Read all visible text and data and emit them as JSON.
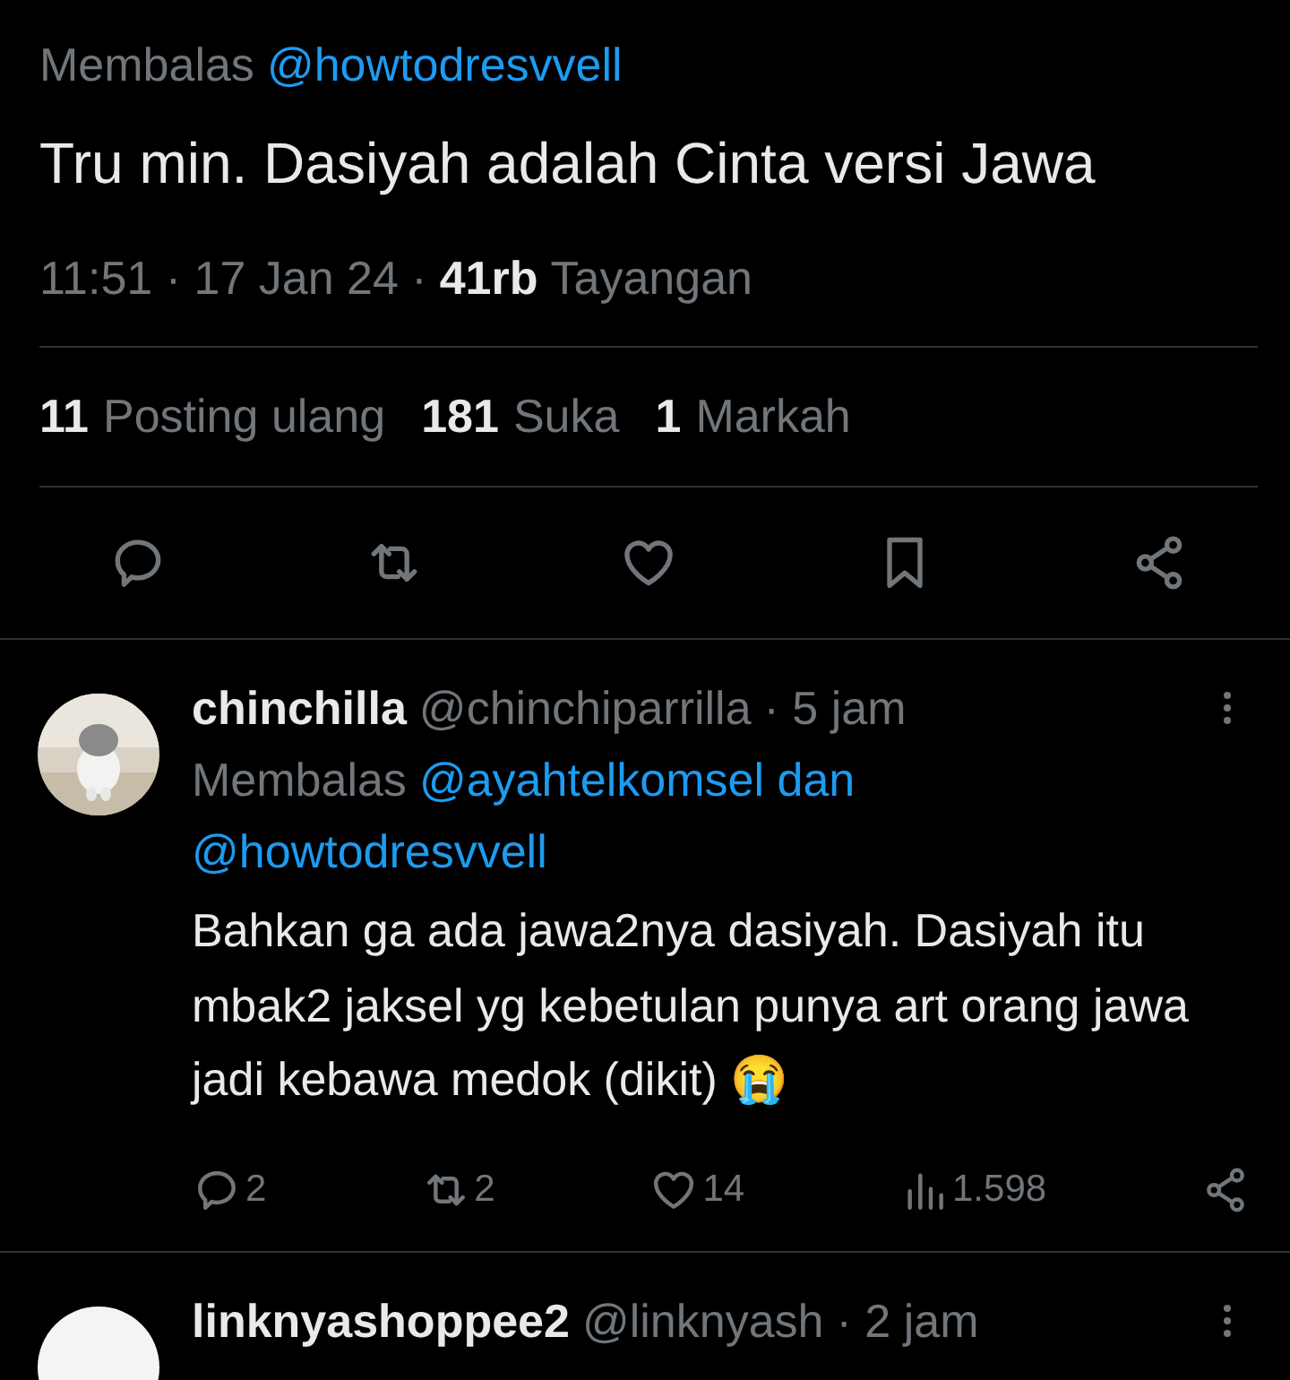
{
  "reply_to": {
    "prefix": "Membalas",
    "handles": [
      "@howtodresvvell"
    ]
  },
  "text": "Tru min. Dasiyah adalah Cinta versi Jawa",
  "meta": {
    "timestamp": "11:51 · 17 Jan 24 ·",
    "views_count": "41rb",
    "views_label": "Tayangan"
  },
  "stats": [
    {
      "count": "11",
      "label": "Posting ulang"
    },
    {
      "count": "181",
      "label": "Suka"
    },
    {
      "count": "1",
      "label": "Markah"
    }
  ],
  "actions": [
    {
      "kind": "reply"
    },
    {
      "kind": "repost"
    },
    {
      "kind": "like"
    },
    {
      "kind": "bookmark"
    },
    {
      "kind": "share"
    }
  ],
  "replies": [
    {
      "name": "chinchilla",
      "handle": "@chinchiparrilla",
      "time": "· 5 jam",
      "reply_to": {
        "prefix": "Membalas",
        "handles": [
          "@ayahtelkomsel dan",
          "@howtodresvvell"
        ]
      },
      "text": "Bahkan ga ada jawa2nya dasiyah. Dasiyah itu mbak2 jaksel yg kebetulan punya art orang jawa jadi kebawa medok (dikit) 😭",
      "actions": [
        {
          "kind": "reply",
          "count": "2"
        },
        {
          "kind": "repost",
          "count": "2"
        },
        {
          "kind": "like",
          "count": "14"
        },
        {
          "kind": "views",
          "count": "1.598"
        },
        {
          "kind": "share"
        }
      ]
    },
    {
      "name": "linknyashoppee2",
      "handle": "@linknyash",
      "time": "· 2 jam"
    }
  ]
}
